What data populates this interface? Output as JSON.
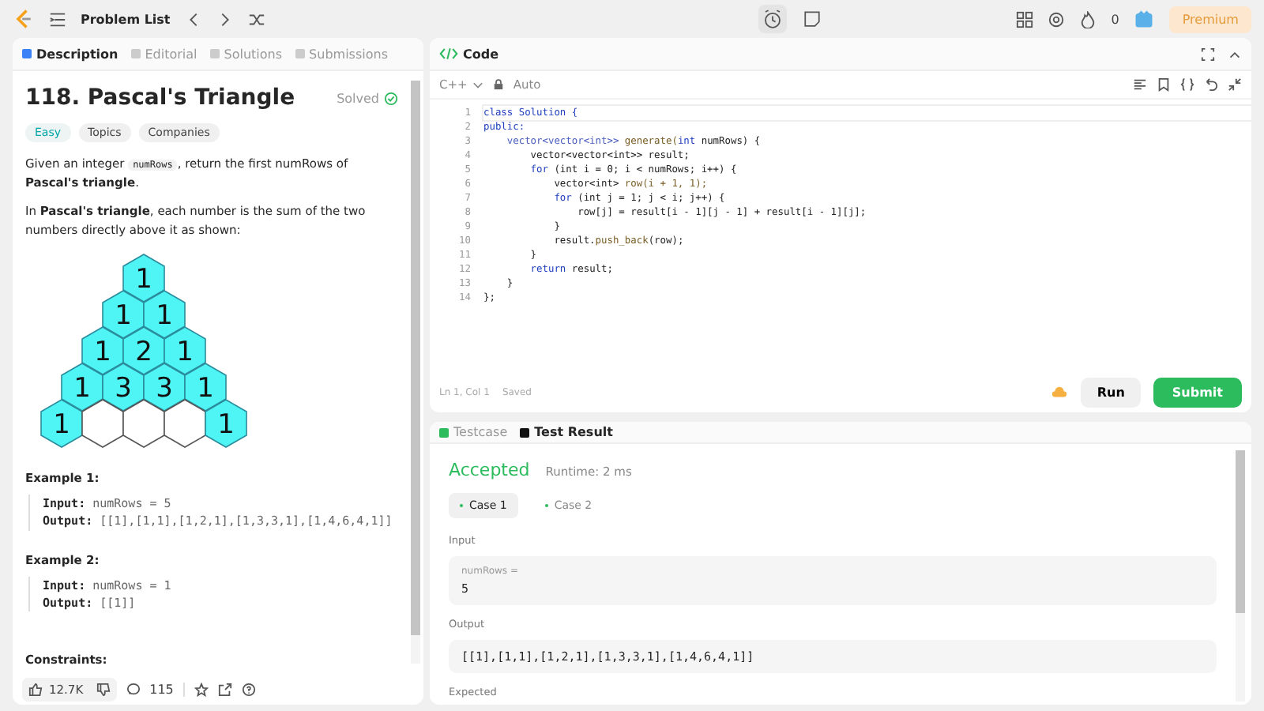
{
  "topbar": {
    "nav_title": "Problem List",
    "streak": "0",
    "premium": "Premium"
  },
  "left_tabs": [
    {
      "label": "Description",
      "selected": true
    },
    {
      "label": "Editorial",
      "selected": false
    },
    {
      "label": "Solutions",
      "selected": false
    },
    {
      "label": "Submissions",
      "selected": false
    }
  ],
  "problem": {
    "title": "118. Pascal's Triangle",
    "status": "Solved",
    "difficulty": "Easy",
    "tags": [
      "Topics",
      "Companies"
    ],
    "intro": [
      "Given an integer ",
      "numRows",
      ", return the first numRows of **Pascal's triangle**."
    ],
    "para": "In **Pascal's triangle**, each number is the sum of the two numbers directly above it as shown:",
    "triangle": [
      [
        {
          "value": "1",
          "filled": true
        }
      ],
      [
        {
          "value": "1",
          "filled": true
        },
        {
          "value": "1",
          "filled": true
        }
      ],
      [
        {
          "value": "1",
          "filled": true
        },
        {
          "value": "2",
          "filled": true
        },
        {
          "value": "1",
          "filled": true
        }
      ],
      [
        {
          "value": "1",
          "filled": true
        },
        {
          "value": "3",
          "filled": true
        },
        {
          "value": "3",
          "filled": true
        },
        {
          "value": "1",
          "filled": true
        }
      ],
      [
        {
          "value": "1",
          "filled": true
        },
        {
          "filled": false
        },
        {
          "filled": false
        },
        {
          "filled": false
        },
        {
          "value": "1",
          "filled": true
        }
      ]
    ],
    "examples": [
      {
        "title": "Example 1:",
        "lines": [
          {
            "label": "Input:",
            "value": "numRows = 5"
          },
          {
            "label": "Output:",
            "value": "[[1],[1,1],[1,2,1],[1,3,3,1],[1,4,6,4,1]]"
          }
        ]
      },
      {
        "title": "Example 2:",
        "lines": [
          {
            "label": "Input:",
            "value": "numRows = 1"
          },
          {
            "label": "Output:",
            "value": "[[1]]"
          }
        ]
      }
    ],
    "constraints_title": "Constraints:"
  },
  "footer": {
    "likes": "12.7K",
    "comments": "115"
  },
  "code": {
    "title": "Code",
    "language": "C++",
    "mode": "Auto",
    "lines": [
      [
        {
          "t": "class Solution {",
          "kind": "kw"
        }
      ],
      [
        {
          "t": "public:",
          "kind": "kw"
        }
      ],
      [
        {
          "t": "    vector<vector<int>> ",
          "kind": "type"
        },
        {
          "t": "generate(",
          "kind": "fn"
        },
        {
          "t": "int ",
          "kind": "kw"
        },
        {
          "t": "numRows) {",
          "kind": "plain"
        }
      ],
      [
        {
          "t": "        vector<vector<int>> result;",
          "kind": "plain"
        }
      ],
      [
        {
          "t": "        for ",
          "kind": "kw"
        },
        {
          "t": "(int i = 0; i < numRows; i++) {",
          "kind": "plain"
        }
      ],
      [
        {
          "t": "            vector<int> ",
          "kind": "plain"
        },
        {
          "t": "row(i + 1, 1);",
          "kind": "fn"
        }
      ],
      [
        {
          "t": "            for ",
          "kind": "kw"
        },
        {
          "t": "(int j = 1; j < i; j++) {",
          "kind": "plain"
        }
      ],
      [
        {
          "t": "                row[j] = result[i - 1][j - 1] + result[i - 1][j];",
          "kind": "plain"
        }
      ],
      [
        {
          "t": "            }",
          "kind": "plain"
        }
      ],
      [
        {
          "t": "            result.",
          "kind": "plain"
        },
        {
          "t": "push_back",
          "kind": "fn"
        },
        {
          "t": "(row);",
          "kind": "plain"
        }
      ],
      [
        {
          "t": "        }",
          "kind": "plain"
        }
      ],
      [
        {
          "t": "        return ",
          "kind": "kw"
        },
        {
          "t": "result;",
          "kind": "plain"
        }
      ],
      [
        {
          "t": "    }",
          "kind": "plain"
        }
      ],
      [
        {
          "t": "};",
          "kind": "plain"
        }
      ]
    ],
    "line_numbers": [
      "1",
      "2",
      "3",
      "4",
      "5",
      "6",
      "7",
      "8",
      "9",
      "10",
      "11",
      "12",
      "13",
      "14"
    ],
    "cursor": "Ln 1, Col 1",
    "saved": "Saved",
    "run": "Run",
    "submit": "Submit"
  },
  "result_tabs": [
    {
      "label": "Testcase",
      "selected": false
    },
    {
      "label": "Test Result",
      "selected": true
    }
  ],
  "result": {
    "verdict": "Accepted",
    "runtime": "Runtime: 2 ms",
    "cases": [
      {
        "label": "Case 1",
        "selected": true
      },
      {
        "label": "Case 2",
        "selected": false
      }
    ],
    "input_label": "Input",
    "param_name": "numRows =",
    "param_value": "5",
    "output_label": "Output",
    "output_value": "[[1],[1,1],[1,2,1],[1,3,3,1],[1,4,6,4,1]]",
    "expected_label": "Expected"
  }
}
